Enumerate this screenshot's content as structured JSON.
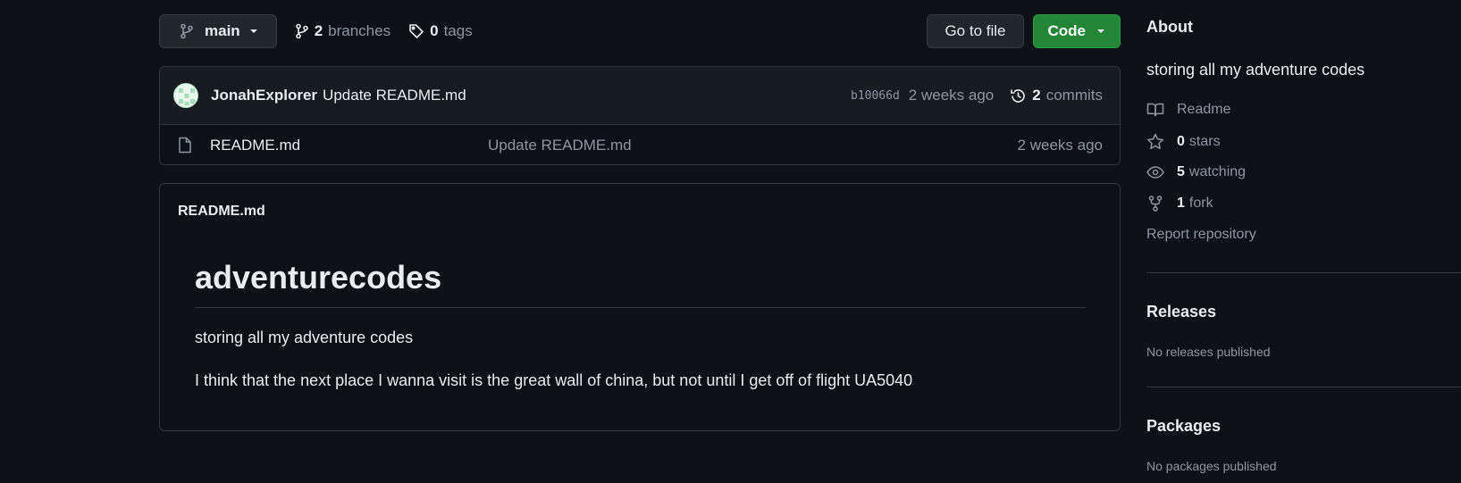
{
  "topbar": {
    "branch_label": "main",
    "branches_count": "2",
    "branches_label": "branches",
    "tags_count": "0",
    "tags_label": "tags",
    "goto_label": "Go to file",
    "code_label": "Code"
  },
  "commit": {
    "author": "JonahExplorer",
    "message": "Update README.md",
    "sha": "b10066d",
    "age": "2 weeks ago",
    "commits_count": "2",
    "commits_label": "commits"
  },
  "files": [
    {
      "name": "README.md",
      "message": "Update README.md",
      "age": "2 weeks ago"
    }
  ],
  "readme": {
    "filename": "README.md",
    "title": "adventurecodes",
    "paragraphs": [
      "storing all my adventure codes",
      "I think that the next place I wanna visit is the great wall of china, but not until I get off of flight UA5040"
    ]
  },
  "sidebar": {
    "about_title": "About",
    "description": "storing all my adventure codes",
    "readme_label": "Readme",
    "stars_count": "0",
    "stars_label": "stars",
    "watching_count": "5",
    "watching_label": "watching",
    "fork_count": "1",
    "fork_label": "fork",
    "report_label": "Report repository",
    "releases_title": "Releases",
    "releases_empty": "No releases published",
    "packages_title": "Packages",
    "packages_empty": "No packages published"
  },
  "colors": {
    "background": "#0d1117",
    "code_button": "#238636",
    "border": "#30363d",
    "muted_text": "#8d96a0"
  }
}
